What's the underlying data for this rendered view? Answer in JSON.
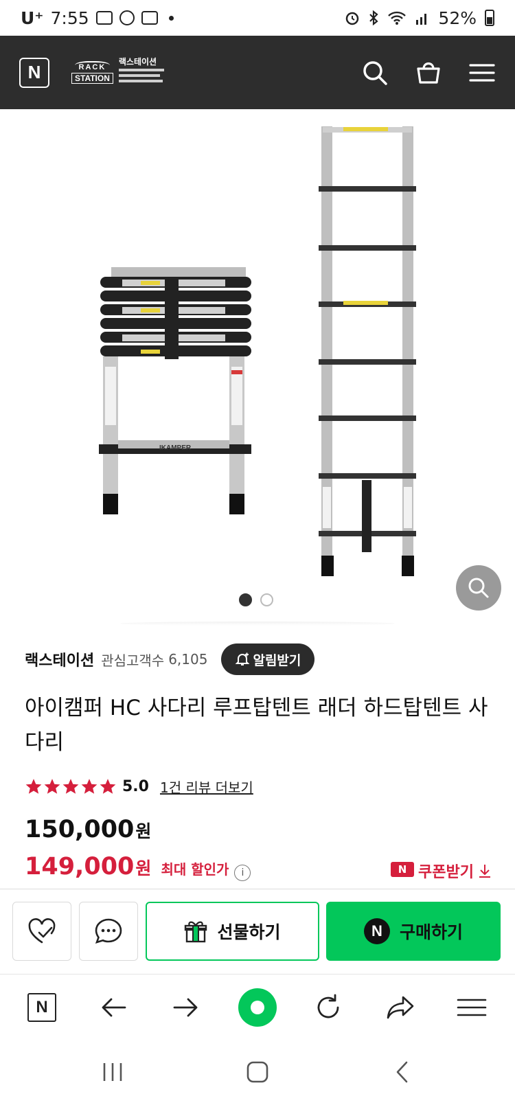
{
  "status_bar": {
    "carrier": "U⁺",
    "time": "7:55",
    "battery": "52%"
  },
  "store_header": {
    "naver_logo": "N",
    "store_logo": {
      "top": "RACK",
      "bottom": "STATION",
      "name": "랙스테이션"
    },
    "icons": [
      "search-icon",
      "cart-icon",
      "menu-icon"
    ]
  },
  "gallery": {
    "image_count": 2,
    "active_index": 0,
    "ladder_brand": "IKAMPER"
  },
  "store": {
    "name": "랙스테이션",
    "follower_label": "관심고객수",
    "follower_count": "6,105",
    "alarm_label": "알림받기"
  },
  "product": {
    "title": "아이캠퍼 HC 사다리 루프탑텐트 래더 하드탑텐트 사다리",
    "rating_stars": 5,
    "rating": "5.0",
    "review_link": "1건 리뷰 더보기",
    "original_price": "150,000",
    "price_unit": "원",
    "sale_price": "149,000",
    "discount_label": "최대 할인가",
    "coupon_badge": "N",
    "coupon_label": "쿠폰받기"
  },
  "actions": {
    "gift_label": "선물하기",
    "buy_label": "구매하기",
    "buy_badge": "N"
  },
  "browser_bar": {
    "naver_label": "N"
  },
  "colors": {
    "naver_green": "#03c75a",
    "sale_red": "#d51f3c",
    "header_bg": "#2d2d2d"
  }
}
